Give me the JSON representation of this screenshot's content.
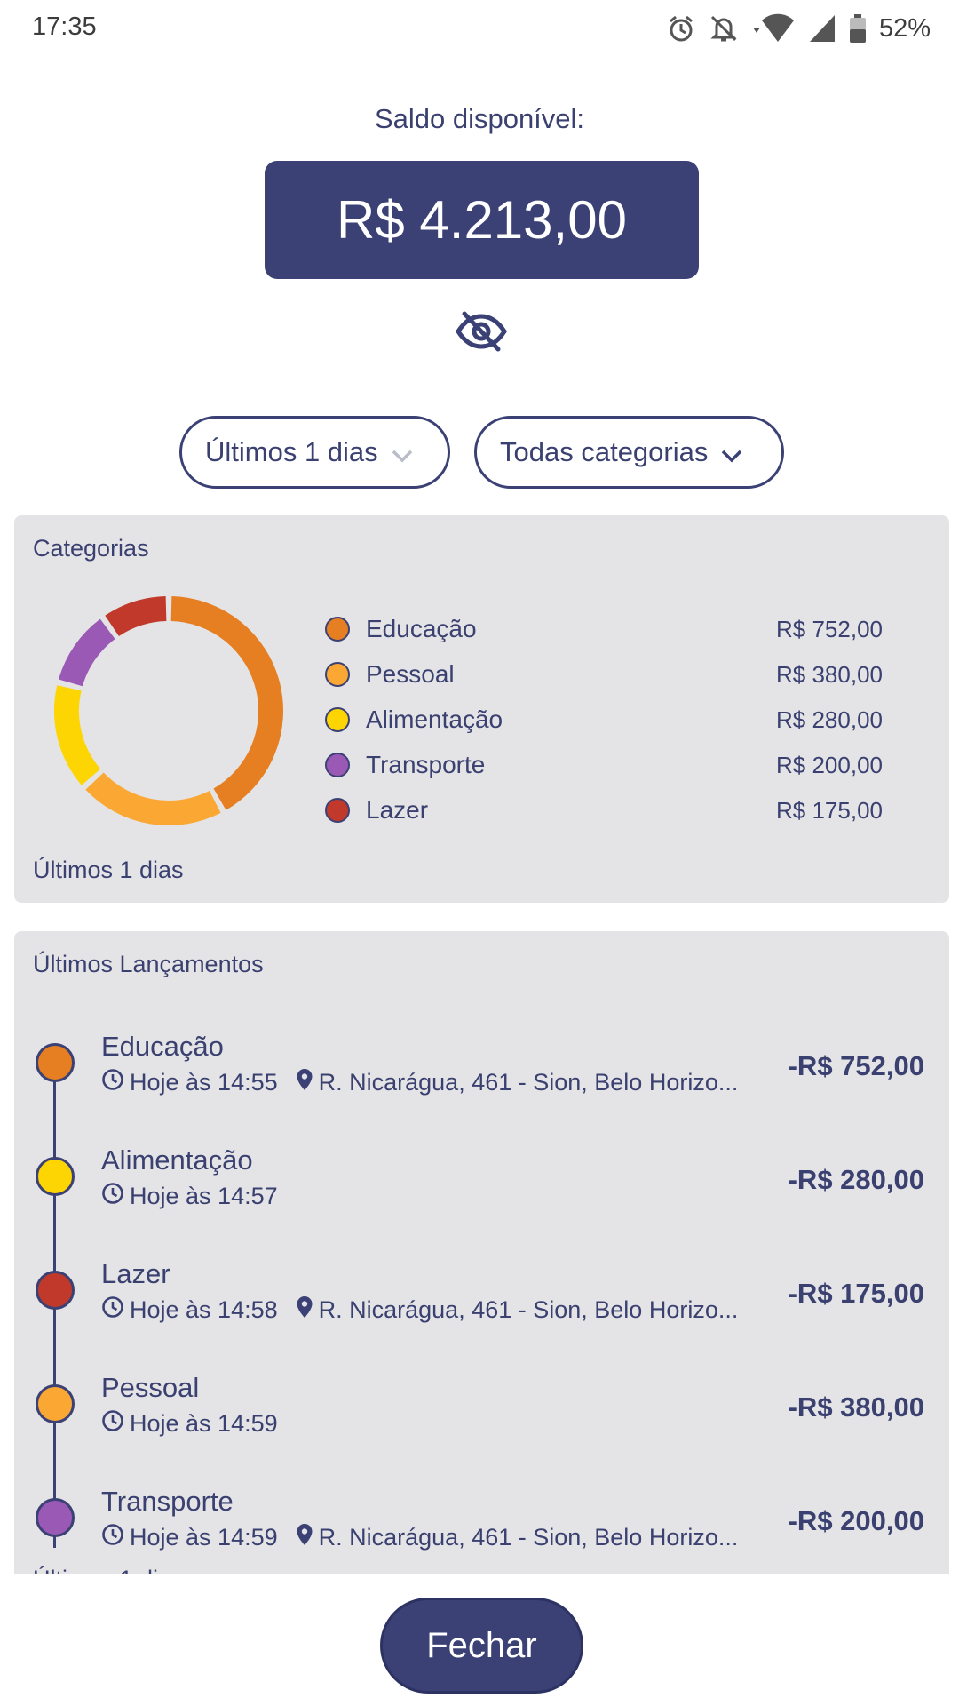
{
  "status_bar": {
    "time": "17:35",
    "battery": "52%",
    "icons": [
      "alarm-icon",
      "notifications-off-icon",
      "wifi-icon",
      "signal-icon",
      "battery-icon"
    ]
  },
  "balance": {
    "label": "Saldo disponível:",
    "value": "R$ 4.213,00",
    "toggle_icon": "eye-off-icon"
  },
  "filters": {
    "period": "Últimos 1 dias",
    "category": "Todas categorias"
  },
  "categories_card": {
    "title": "Categorias",
    "footer": "Últimos 1 dias",
    "items": [
      {
        "name": "Educação",
        "value": "R$ 752,00",
        "amount": 752,
        "color": "#e67e22"
      },
      {
        "name": "Pessoal",
        "value": "R$ 380,00",
        "amount": 380,
        "color": "#fba733"
      },
      {
        "name": "Alimentação",
        "value": "R$ 280,00",
        "amount": 280,
        "color": "#fcd502"
      },
      {
        "name": "Transporte",
        "value": "R$ 200,00",
        "amount": 200,
        "color": "#9b59b6"
      },
      {
        "name": "Lazer",
        "value": "R$ 175,00",
        "amount": 175,
        "color": "#c0392b"
      }
    ]
  },
  "transactions_card": {
    "title": "Últimos Lançamentos",
    "items": [
      {
        "category": "Educação",
        "time": "Hoje às 14:55",
        "location": "R. Nicarágua, 461 - Sion, Belo Horizo...",
        "amount": "-R$ 752,00",
        "color": "#e67e22"
      },
      {
        "category": "Alimentação",
        "time": "Hoje às 14:57",
        "location": "",
        "amount": "-R$ 280,00",
        "color": "#fcd502"
      },
      {
        "category": "Lazer",
        "time": "Hoje às 14:58",
        "location": "R. Nicarágua, 461 - Sion, Belo Horizo...",
        "amount": "-R$ 175,00",
        "color": "#c0392b"
      },
      {
        "category": "Pessoal",
        "time": "Hoje às 14:59",
        "location": "",
        "amount": "-R$ 380,00",
        "color": "#fba733"
      },
      {
        "category": "Transporte",
        "time": "Hoje às 14:59",
        "location": "R. Nicarágua, 461 - Sion, Belo Horizo...",
        "amount": "-R$ 200,00",
        "color": "#9b59b6"
      }
    ]
  },
  "close_button": {
    "label": "Fechar"
  }
}
